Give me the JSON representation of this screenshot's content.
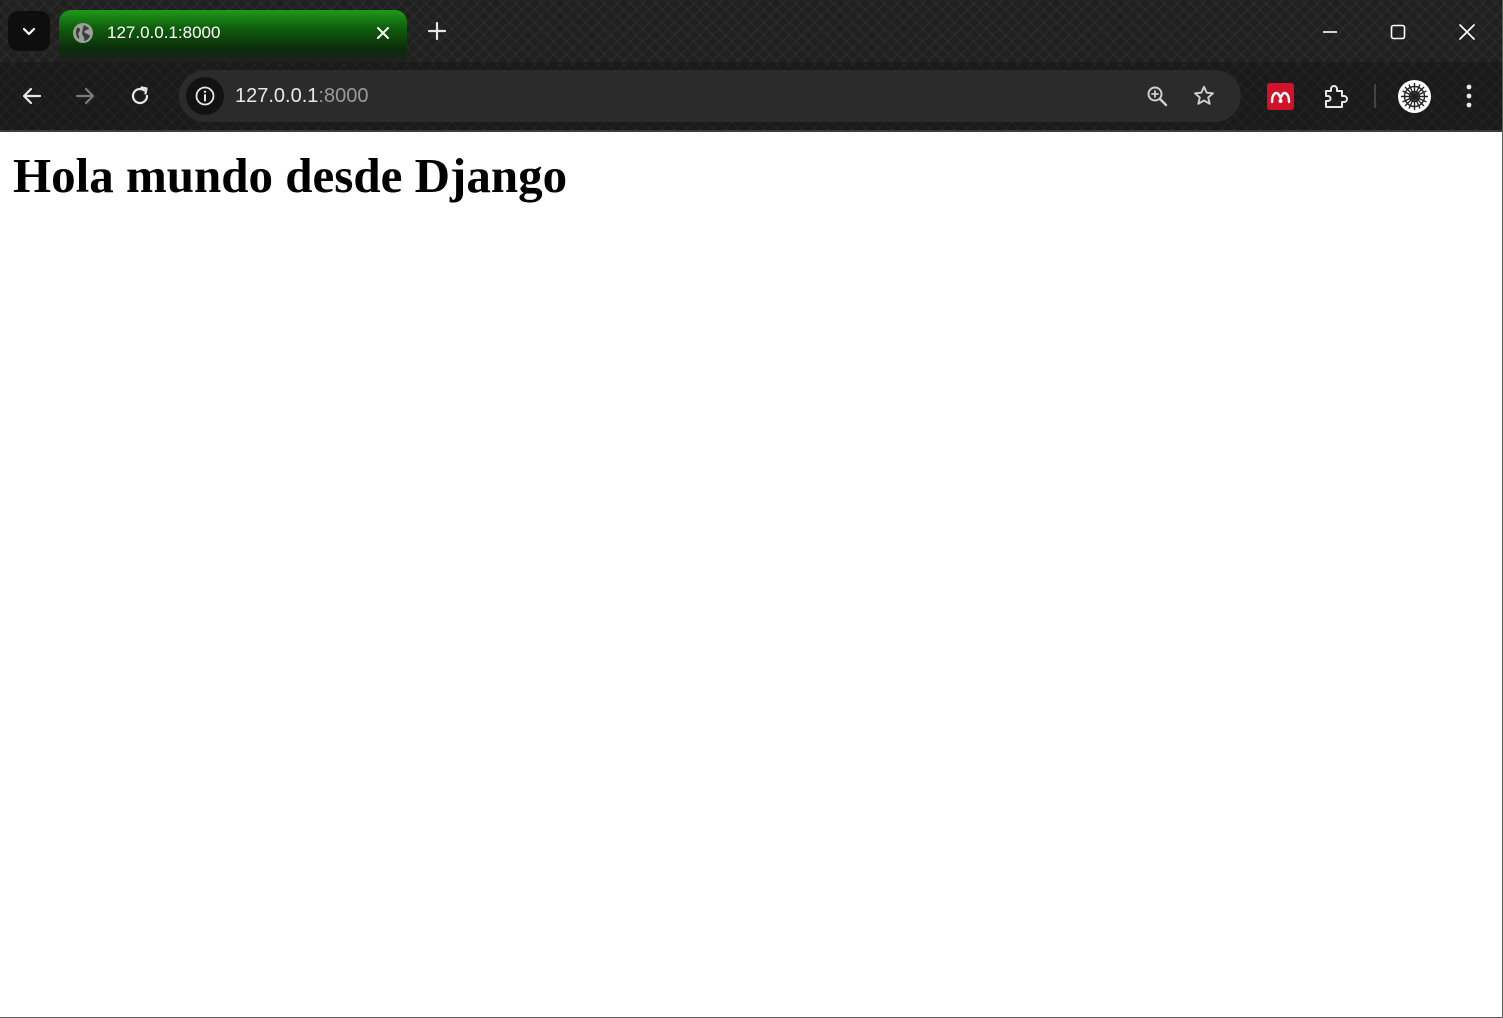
{
  "browser": {
    "tab": {
      "title": "127.0.0.1:8000",
      "favicon": "globe-icon"
    },
    "address_bar": {
      "host": "127.0.0.1",
      "port": ":8000"
    },
    "extensions": [
      "mendeley-icon",
      "puzzle-icon"
    ],
    "colors": {
      "active_tab_accent": "#1f9a1a",
      "mendeley_red": "#d1122a"
    }
  },
  "page": {
    "heading": "Hola mundo desde Django"
  }
}
